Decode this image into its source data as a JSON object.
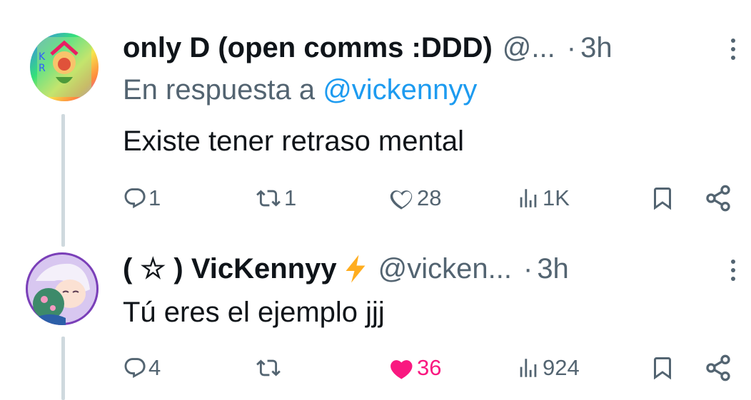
{
  "tweets": [
    {
      "display_name": "only D (open comms :DDD)",
      "handle": "@...",
      "separator": "·",
      "time": "3h",
      "reply_to_label": "En respuesta a",
      "reply_to_mention": "@vickennyy",
      "text": "Existe tener retraso mental",
      "avatar_icon": "joker-card-avatar",
      "actions": {
        "replies": "1",
        "reposts": "1",
        "likes": "28",
        "views": "1K"
      },
      "liked": false
    },
    {
      "display_name": "( ☆ ) VicKennyy",
      "badge_icon": "lightning-bolt-icon",
      "handle": "@vicken...",
      "separator": "·",
      "time": "3h",
      "text": "Tú eres el ejemplo jjj",
      "avatar_icon": "anime-character-avatar",
      "actions": {
        "replies": "4",
        "reposts": "",
        "likes": "36",
        "views": "924"
      },
      "liked": true
    }
  ],
  "colors": {
    "text": "#0f1419",
    "secondary": "#536471",
    "link": "#1d9bf0",
    "like": "#f91880",
    "thread_line": "#cfd9de",
    "badge": "#ffad1f"
  }
}
